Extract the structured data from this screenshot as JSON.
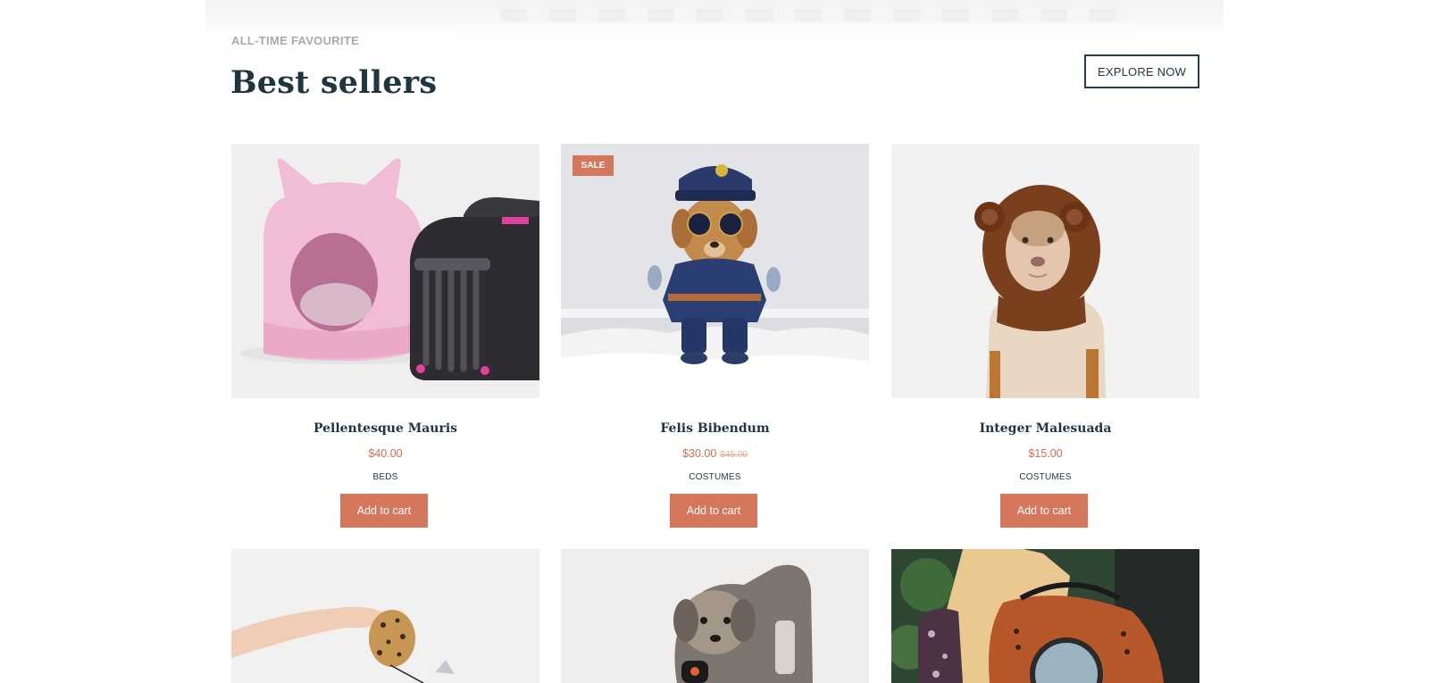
{
  "section": {
    "eyebrow": "ALL-TIME FAVOURITE",
    "title": "Best sellers",
    "explore_label": "EXPLORE NOW"
  },
  "products": [
    {
      "name": "Pellentesque Mauris",
      "price": "$40.00",
      "old_price": "",
      "category": "BEDS",
      "cart_label": "Add to cart",
      "badge": ""
    },
    {
      "name": "Felis Bibendum",
      "price": "$30.00",
      "old_price": "$45.00",
      "category": "COSTUMES",
      "cart_label": "Add to cart",
      "badge": "SALE"
    },
    {
      "name": "Integer Malesuada",
      "price": "$15.00",
      "old_price": "",
      "category": "COSTUMES",
      "cart_label": "Add to cart",
      "badge": ""
    }
  ],
  "colors": {
    "accent": "#d4775b",
    "heading": "#1f3640",
    "muted": "#a7a9ab"
  }
}
